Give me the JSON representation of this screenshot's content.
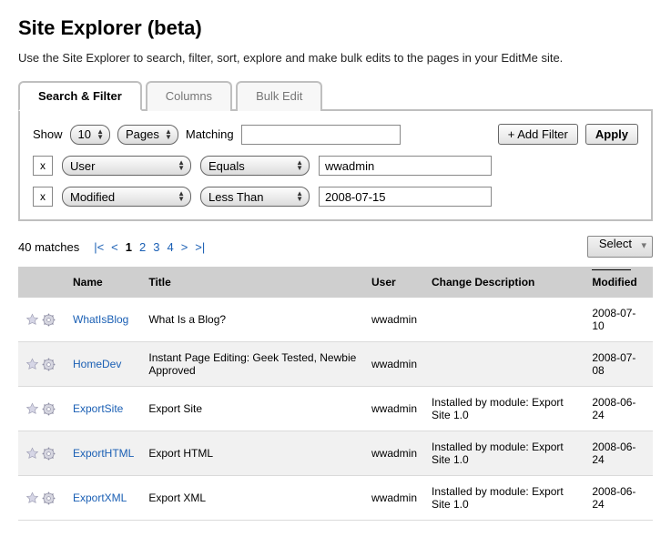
{
  "title": "Site Explorer (beta)",
  "intro": "Use the Site Explorer to search, filter, sort, explore and make bulk edits to the pages in your EditMe site.",
  "tabs": [
    {
      "label": "Search & Filter",
      "active": true
    },
    {
      "label": "Columns",
      "active": false
    },
    {
      "label": "Bulk Edit",
      "active": false
    }
  ],
  "filterBar": {
    "showLabel": "Show",
    "showCount": "10",
    "itemType": "Pages",
    "matchingLabel": "Matching",
    "matchingValue": "",
    "addFilter": "+ Add Filter",
    "apply": "Apply"
  },
  "filterRows": [
    {
      "remove": "x",
      "field": "User",
      "op": "Equals",
      "value": "wwadmin"
    },
    {
      "remove": "x",
      "field": "Modified",
      "op": "Less Than",
      "value": "2008-07-15"
    }
  ],
  "results": {
    "matches": "40 matches",
    "first": "|<",
    "prev": "<",
    "pages": [
      "1",
      "2",
      "3",
      "4"
    ],
    "currentPage": "1",
    "next": ">",
    "last": ">|",
    "selectLabel": "Select"
  },
  "table": {
    "headers": {
      "name": "Name",
      "title": "Title",
      "user": "User",
      "change": "Change Description",
      "modified": "Modified"
    },
    "rows": [
      {
        "name": "WhatIsBlog",
        "title": "What Is a Blog?",
        "user": "wwadmin",
        "change": "",
        "modified": "2008-07-10"
      },
      {
        "name": "HomeDev",
        "title": "Instant Page Editing: Geek Tested, Newbie Approved",
        "user": "wwadmin",
        "change": "",
        "modified": "2008-07-08"
      },
      {
        "name": "ExportSite",
        "title": "Export Site",
        "user": "wwadmin",
        "change": "Installed by module: Export Site 1.0",
        "modified": "2008-06-24"
      },
      {
        "name": "ExportHTML",
        "title": "Export HTML",
        "user": "wwadmin",
        "change": "Installed by module: Export Site 1.0",
        "modified": "2008-06-24"
      },
      {
        "name": "ExportXML",
        "title": "Export XML",
        "user": "wwadmin",
        "change": "Installed by module: Export Site 1.0",
        "modified": "2008-06-24"
      }
    ]
  }
}
